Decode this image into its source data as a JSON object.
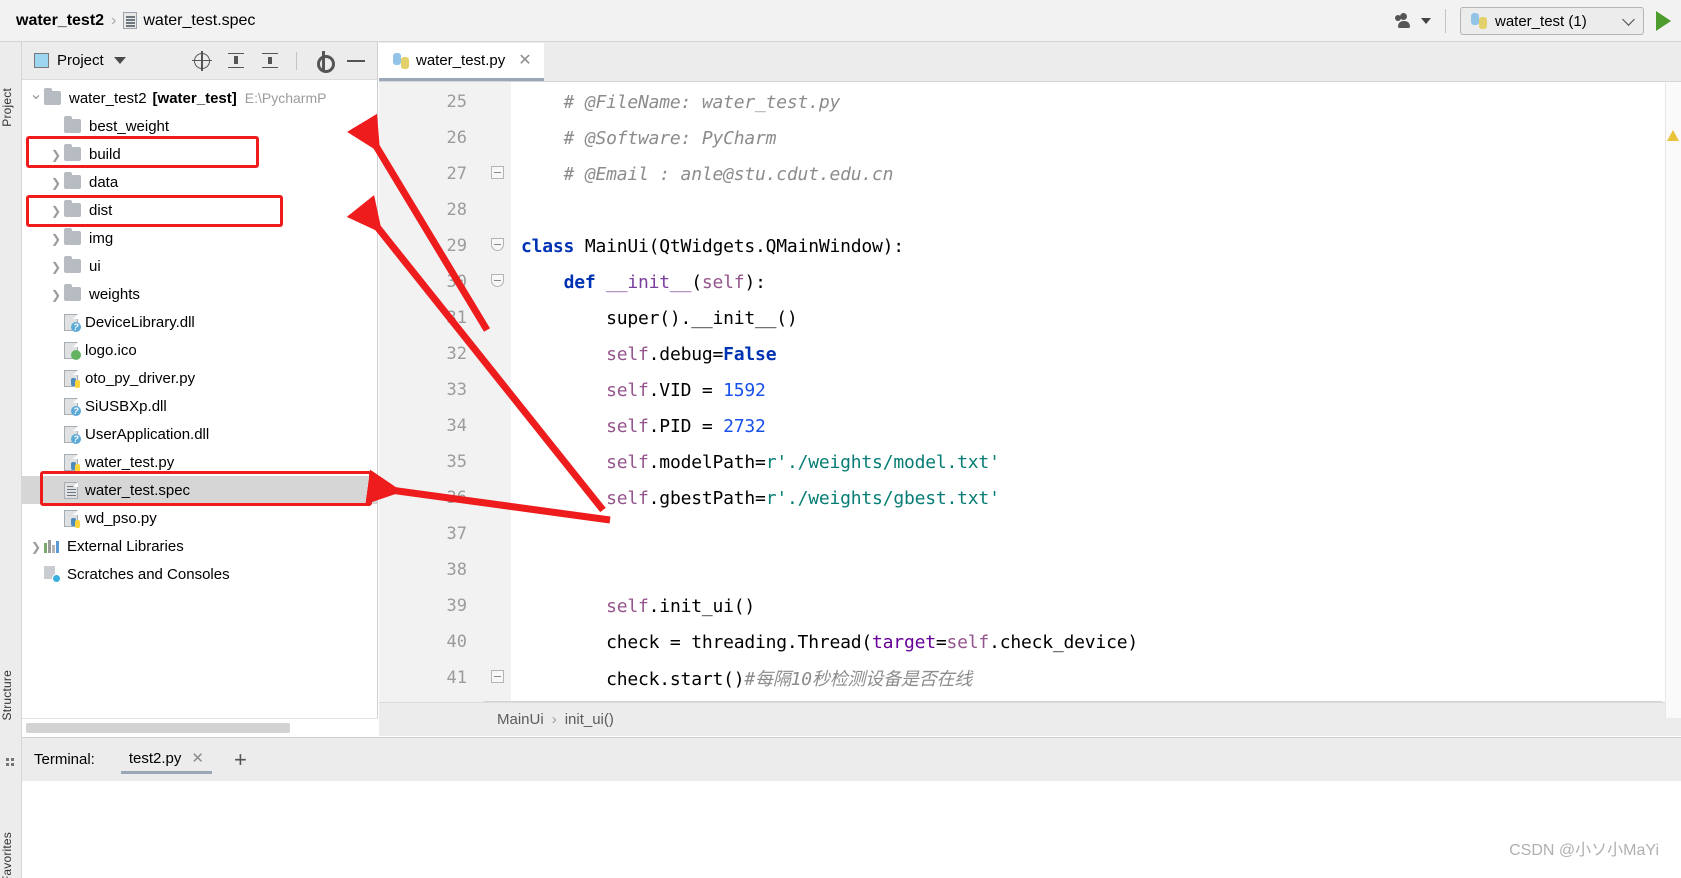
{
  "titlebar": {
    "breadcrumb_root": "water_test2",
    "breadcrumb_sep": "›",
    "breadcrumb_file": "water_test.spec",
    "run_config": "water_test (1)"
  },
  "left_strip": {
    "project_label": "Project",
    "structure_label": "Structure",
    "favorites_label": "Favorites"
  },
  "project_panel": {
    "title": "Project",
    "tree": [
      {
        "label": "water_test2",
        "bold_label": "[water_test]",
        "path": "E:\\PycharmP",
        "arrow": "open",
        "icon": "folder",
        "depth": 0,
        "selected": false
      },
      {
        "label": "best_weight",
        "arrow": "none",
        "icon": "folder",
        "depth": 1,
        "selected": false
      },
      {
        "label": "build",
        "arrow": "closed",
        "icon": "folder",
        "depth": 1,
        "selected": false
      },
      {
        "label": "data",
        "arrow": "closed",
        "icon": "folder",
        "depth": 1,
        "selected": false
      },
      {
        "label": "dist",
        "arrow": "closed",
        "icon": "folder",
        "depth": 1,
        "selected": false
      },
      {
        "label": "img",
        "arrow": "closed",
        "icon": "folder",
        "depth": 1,
        "selected": false
      },
      {
        "label": "ui",
        "arrow": "closed",
        "icon": "folder",
        "depth": 1,
        "selected": false
      },
      {
        "label": "weights",
        "arrow": "closed",
        "icon": "folder",
        "depth": 1,
        "selected": false
      },
      {
        "label": "DeviceLibrary.dll",
        "arrow": "none",
        "icon": "unknown-file",
        "depth": 1,
        "selected": false
      },
      {
        "label": "logo.ico",
        "arrow": "none",
        "icon": "image-file",
        "depth": 1,
        "selected": false
      },
      {
        "label": "oto_py_driver.py",
        "arrow": "none",
        "icon": "python-file",
        "depth": 1,
        "selected": false
      },
      {
        "label": "SiUSBXp.dll",
        "arrow": "none",
        "icon": "unknown-file",
        "depth": 1,
        "selected": false
      },
      {
        "label": "UserApplication.dll",
        "arrow": "none",
        "icon": "unknown-file",
        "depth": 1,
        "selected": false
      },
      {
        "label": "water_test.py",
        "arrow": "none",
        "icon": "python-file",
        "depth": 1,
        "selected": false
      },
      {
        "label": "water_test.spec",
        "arrow": "none",
        "icon": "spec-file",
        "depth": 1,
        "selected": true
      },
      {
        "label": "wd_pso.py",
        "arrow": "none",
        "icon": "python-file",
        "depth": 1,
        "selected": false
      },
      {
        "label": "External Libraries",
        "arrow": "closed",
        "icon": "library",
        "depth": 0,
        "selected": false
      },
      {
        "label": "Scratches and Consoles",
        "arrow": "none",
        "icon": "scratch",
        "depth": 0,
        "selected": false
      }
    ]
  },
  "editor": {
    "tab_label": "water_test.py",
    "tab_close": "✕",
    "lines": [
      {
        "n": "25",
        "fold": "none",
        "segments": [
          {
            "t": "    # @FileName: water_test.py",
            "c": "cm"
          }
        ]
      },
      {
        "n": "26",
        "fold": "none",
        "segments": [
          {
            "t": "    # @Software: PyCharm",
            "c": "cm"
          }
        ]
      },
      {
        "n": "27",
        "fold": "end",
        "segments": [
          {
            "t": "    # @Email : anle@stu.cdut.edu.cn",
            "c": "cm"
          }
        ]
      },
      {
        "n": "28",
        "fold": "none",
        "segments": [
          {
            "t": "",
            "c": "pl"
          }
        ]
      },
      {
        "n": "29",
        "fold": "open",
        "segments": [
          {
            "t": "class ",
            "c": "k"
          },
          {
            "t": "MainUi(QtWidgets.QMainWindow):",
            "c": "pl"
          }
        ]
      },
      {
        "n": "30",
        "fold": "open",
        "segments": [
          {
            "t": "    ",
            "c": "pl"
          },
          {
            "t": "def ",
            "c": "k"
          },
          {
            "t": "__init__",
            "c": "mg"
          },
          {
            "t": "(",
            "c": "pl"
          },
          {
            "t": "self",
            "c": "sf"
          },
          {
            "t": "):",
            "c": "pl"
          }
        ]
      },
      {
        "n": "31",
        "fold": "none",
        "segments": [
          {
            "t": "        super().__init__()",
            "c": "pl"
          }
        ]
      },
      {
        "n": "32",
        "fold": "none",
        "segments": [
          {
            "t": "        ",
            "c": "pl"
          },
          {
            "t": "self",
            "c": "sf"
          },
          {
            "t": ".debug=",
            "c": "pl"
          },
          {
            "t": "False",
            "c": "k"
          }
        ]
      },
      {
        "n": "33",
        "fold": "none",
        "segments": [
          {
            "t": "        ",
            "c": "pl"
          },
          {
            "t": "self",
            "c": "sf"
          },
          {
            "t": ".VID = ",
            "c": "pl"
          },
          {
            "t": "1592",
            "c": "nm"
          }
        ]
      },
      {
        "n": "34",
        "fold": "none",
        "segments": [
          {
            "t": "        ",
            "c": "pl"
          },
          {
            "t": "self",
            "c": "sf"
          },
          {
            "t": ".PID = ",
            "c": "pl"
          },
          {
            "t": "2732",
            "c": "nm"
          }
        ]
      },
      {
        "n": "35",
        "fold": "none",
        "segments": [
          {
            "t": "        ",
            "c": "pl"
          },
          {
            "t": "self",
            "c": "sf"
          },
          {
            "t": ".modelPath=",
            "c": "pl"
          },
          {
            "t": "r'./weights/model.txt'",
            "c": "st"
          }
        ]
      },
      {
        "n": "36",
        "fold": "none",
        "segments": [
          {
            "t": "        ",
            "c": "pl"
          },
          {
            "t": "self",
            "c": "sf"
          },
          {
            "t": ".gbestPath=",
            "c": "pl"
          },
          {
            "t": "r'./weights/gbest.txt'",
            "c": "st"
          }
        ]
      },
      {
        "n": "37",
        "fold": "none",
        "segments": [
          {
            "t": "",
            "c": "pl"
          }
        ]
      },
      {
        "n": "38",
        "fold": "none",
        "segments": [
          {
            "t": "",
            "c": "pl"
          }
        ]
      },
      {
        "n": "39",
        "fold": "none",
        "segments": [
          {
            "t": "        ",
            "c": "pl"
          },
          {
            "t": "self",
            "c": "sf"
          },
          {
            "t": ".init_ui()",
            "c": "pl"
          }
        ]
      },
      {
        "n": "40",
        "fold": "none",
        "segments": [
          {
            "t": "        check = threading.Thread(",
            "c": "pl"
          },
          {
            "t": "target",
            "c": "kw"
          },
          {
            "t": "=",
            "c": "pl"
          },
          {
            "t": "self",
            "c": "sf"
          },
          {
            "t": ".check_device)",
            "c": "pl"
          }
        ]
      },
      {
        "n": "41",
        "fold": "end",
        "segments": [
          {
            "t": "        check.start()",
            "c": "pl"
          },
          {
            "t": "#每隔10秒检测设备是否在线",
            "c": "cm"
          }
        ]
      }
    ],
    "breadcrumb": [
      "MainUi",
      "init_ui()"
    ],
    "breadcrumb_sep": "›"
  },
  "terminal": {
    "title": "Terminal:",
    "tab_label": "test2.py",
    "tab_close": "✕",
    "add_label": "+"
  },
  "watermark": "CSDN @小ソ小MaYi",
  "colors": {
    "annotation_red": "#ee1c1c",
    "selection_gray": "#d6d6d6",
    "panel_gray": "#ececec",
    "keyword_blue": "#0033b3",
    "string_teal": "#067d74",
    "number_blue": "#1750eb",
    "comment_gray": "#8c8c8c",
    "self_purple": "#94558d"
  }
}
